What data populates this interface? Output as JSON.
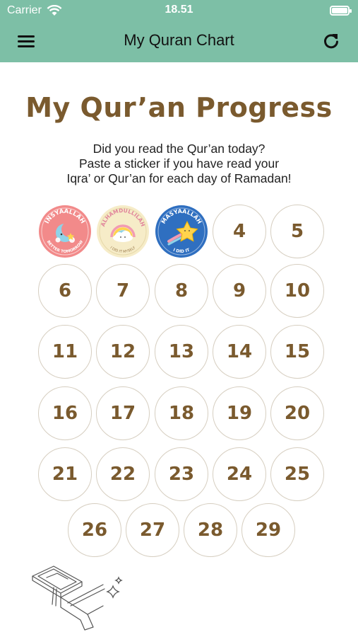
{
  "status_bar": {
    "carrier": "Carrier",
    "time": "18.51"
  },
  "nav": {
    "title": "My Quran Chart"
  },
  "page": {
    "title": "My Qur’an Progress",
    "instructions": [
      "Did you read the Qur’an today?",
      "Paste a sticker if you have read your",
      "Iqra’ or Qur’an for each day of Ramadan!"
    ]
  },
  "stickers": [
    {
      "day": 1,
      "arc_text": "INSYAALLAH",
      "bottom_text": "BETTER TOMORROW",
      "color": "#f28a8a",
      "icon": "moon-icon"
    },
    {
      "day": 2,
      "arc_text": "ALHAMDULLILAH",
      "bottom_text": "I DID IT MYSELF",
      "color": "#f6ecc8",
      "icon": "rainbow-cloud-icon"
    },
    {
      "day": 3,
      "arc_text": "MASYAALLAH",
      "bottom_text": "I DID IT",
      "color": "#2f6fc0",
      "icon": "star-icon"
    }
  ],
  "days": [
    "4",
    "5",
    "6",
    "7",
    "8",
    "9",
    "10",
    "11",
    "12",
    "13",
    "14",
    "15",
    "16",
    "17",
    "18",
    "19",
    "20",
    "21",
    "22",
    "23",
    "24",
    "25",
    "26",
    "27",
    "28",
    "29"
  ],
  "colors": {
    "header": "#7dbfa6",
    "accent_brown": "#7a5a2e"
  }
}
